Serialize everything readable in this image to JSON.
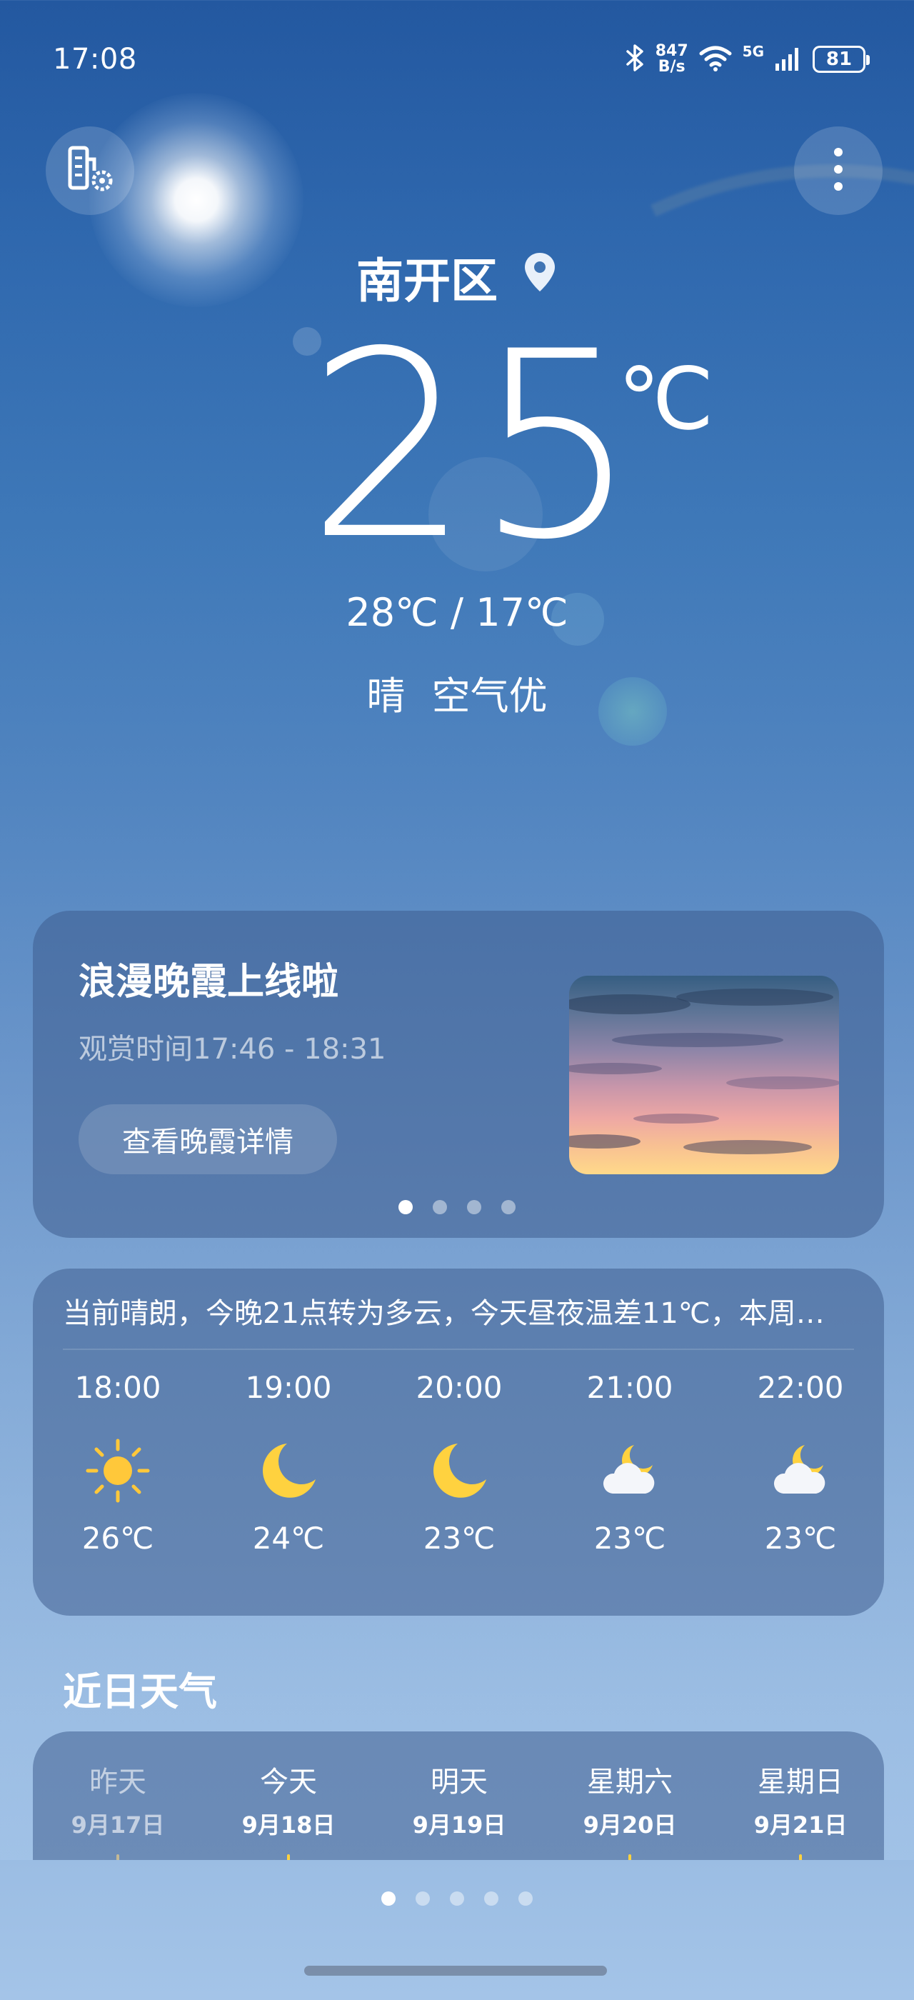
{
  "status_bar": {
    "time": "17:08",
    "net_speed_value": "847",
    "net_speed_unit": "B/s",
    "network": "5G",
    "battery": "81",
    "icons": [
      "bluetooth-icon",
      "wifi-icon",
      "signal-icon",
      "battery-icon"
    ]
  },
  "toolbar": {
    "left_icon": "city-settings-icon",
    "right_icon": "more-vertical-icon"
  },
  "weather": {
    "location": "南开区",
    "location_icon": "location-pin-icon",
    "temperature": "25",
    "unit": "℃",
    "range": "28℃ / 17℃",
    "condition": "晴 空气优"
  },
  "promo": {
    "title": "浪漫晚霞上线啦",
    "subtitle": "观赏时间17:46 - 18:31",
    "button": "查看晚霞详情",
    "page_count": 4,
    "active_page": 0
  },
  "hourly": {
    "summary": "当前晴朗，今晚21点转为多云，今天昼夜温差11℃，本周…",
    "items": [
      {
        "time": "18:00",
        "icon": "sun-icon",
        "temp": "26℃"
      },
      {
        "time": "19:00",
        "icon": "moon-icon",
        "temp": "24℃"
      },
      {
        "time": "20:00",
        "icon": "moon-icon",
        "temp": "23℃"
      },
      {
        "time": "21:00",
        "icon": "cloudy-night-icon",
        "temp": "23℃"
      },
      {
        "time": "22:00",
        "icon": "cloudy-night-icon",
        "temp": "23℃"
      }
    ]
  },
  "recent": {
    "title": "近日天气",
    "days": [
      {
        "name": "昨天",
        "date": "9月17日",
        "dim": true
      },
      {
        "name": "今天",
        "date": "9月18日",
        "dim": false
      },
      {
        "name": "明天",
        "date": "9月19日",
        "dim": false
      },
      {
        "name": "星期六",
        "date": "9月20日",
        "dim": false
      },
      {
        "name": "星期日",
        "date": "9月21日",
        "dim": false
      }
    ]
  },
  "pager": {
    "count": 5,
    "active": 0
  },
  "colors": {
    "sun": "#FFC83A",
    "moon": "#FFD23F",
    "card": "#3C5A8C"
  }
}
